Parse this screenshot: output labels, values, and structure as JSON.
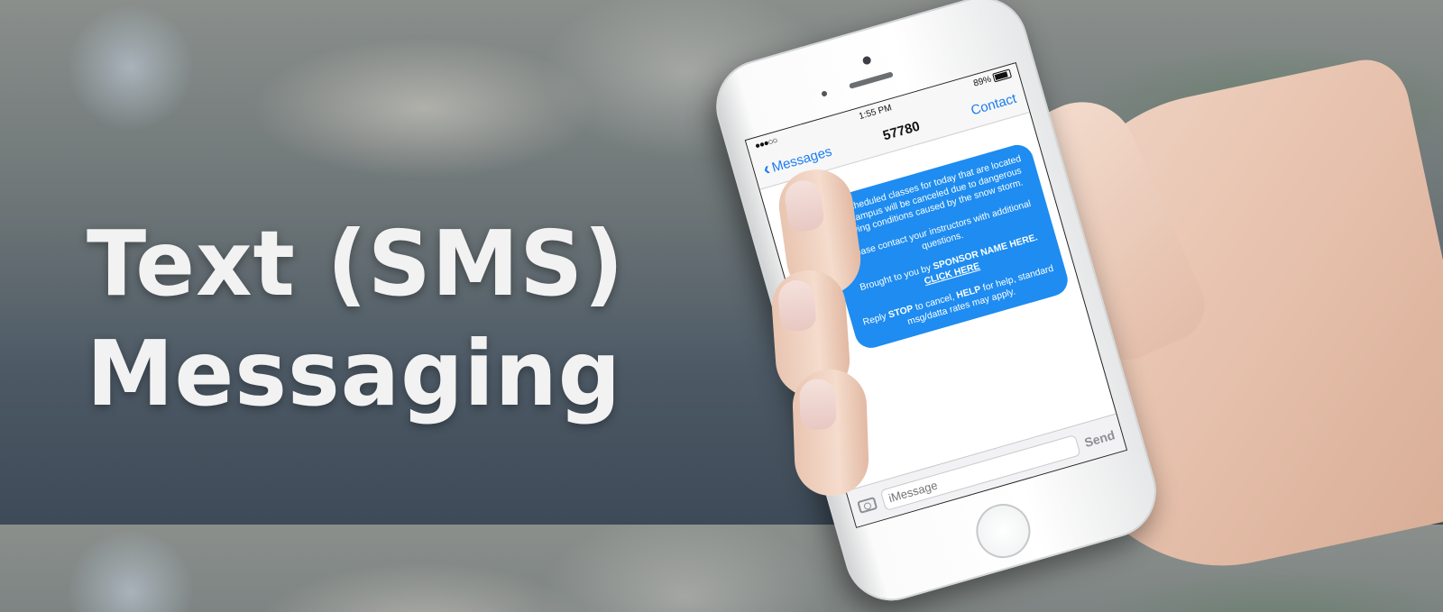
{
  "headline": {
    "line1": "Text (SMS)",
    "line2": "Messaging"
  },
  "phone": {
    "status_bar": {
      "signal": "●●●○○",
      "time": "1:55 PM",
      "battery": "89%"
    },
    "nav": {
      "back_label": "Messages",
      "title": "57780",
      "contact_label": "Contact"
    },
    "message": {
      "para1": "All scheduled classes for today that are located on campus will be canceled due to dangerous driving conditions caused by the snow storm.",
      "para2": "Please contact  your instructors with additional questions.",
      "para3_prefix": "Brought to you by ",
      "para3_sponsor": "SPONSOR NAME HERE.",
      "para3_link": "CLICK HERE",
      "para4_reply": "Reply ",
      "para4_stop": "STOP",
      "para4_mid": " to cancel, ",
      "para4_help": "HELP",
      "para4_rest": " for help, standard msg/datta rates may apply."
    },
    "input": {
      "placeholder": "iMessage",
      "send_label": "Send"
    }
  },
  "colors": {
    "bubble": "#1e8cf0",
    "ios_blue": "#1a7cf0",
    "headline": "#f2f2f2"
  }
}
